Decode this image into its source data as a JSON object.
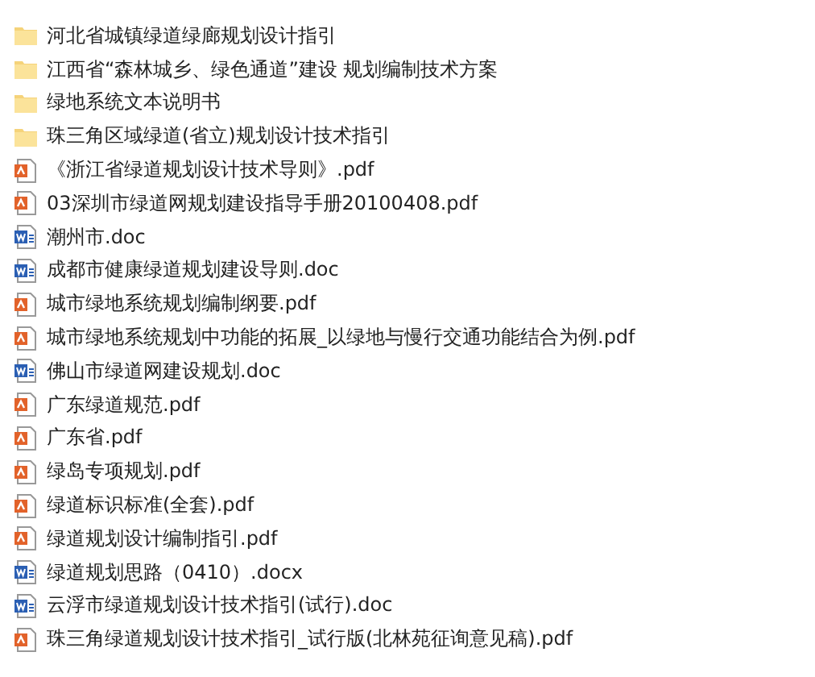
{
  "files": [
    {
      "kind": "folder",
      "name": "河北省城镇绿道绿廊规划设计指引"
    },
    {
      "kind": "folder",
      "name": "江西省“森林城乡、绿色通道”建设 规划编制技术方案"
    },
    {
      "kind": "folder",
      "name": "绿地系统文本说明书"
    },
    {
      "kind": "folder",
      "name": "珠三角区域绿道(省立)规划设计技术指引"
    },
    {
      "kind": "pdf",
      "name": "《浙江省绿道规划设计技术导则》.pdf"
    },
    {
      "kind": "pdf",
      "name": "03深圳市绿道网规划建设指导手册20100408.pdf"
    },
    {
      "kind": "doc",
      "name": "潮州市.doc"
    },
    {
      "kind": "doc",
      "name": "成都市健康绿道规划建设导则.doc"
    },
    {
      "kind": "pdf",
      "name": "城市绿地系统规划编制纲要.pdf"
    },
    {
      "kind": "pdf",
      "name": "城市绿地系统规划中功能的拓展_以绿地与慢行交通功能结合为例.pdf"
    },
    {
      "kind": "doc",
      "name": "佛山市绿道网建设规划.doc"
    },
    {
      "kind": "pdf",
      "name": "广东绿道规范.pdf"
    },
    {
      "kind": "pdf",
      "name": "广东省.pdf"
    },
    {
      "kind": "pdf",
      "name": "绿岛专项规划.pdf"
    },
    {
      "kind": "pdf",
      "name": "绿道标识标准(全套).pdf"
    },
    {
      "kind": "pdf",
      "name": "绿道规划设计编制指引.pdf"
    },
    {
      "kind": "doc",
      "name": "绿道规划思路（0410）.docx"
    },
    {
      "kind": "doc",
      "name": "云浮市绿道规划设计技术指引(试行).doc"
    },
    {
      "kind": "pdf",
      "name": "珠三角绿道规划设计技术指引_试行版(北林苑征询意见稿).pdf"
    }
  ]
}
